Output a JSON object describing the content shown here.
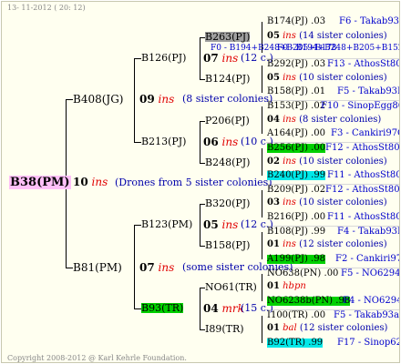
{
  "header": {
    "date": "13- 11-2012 ( 20: 12)"
  },
  "footer": {
    "copyright": "Copyright 2008-2012 @ Karl Kehrle Foundation."
  },
  "root": {
    "name": "B38(PM)",
    "year": "10",
    "tag": "ins",
    "note": "(Drones from 5 sister colonies)"
  },
  "gen1": {
    "sire": "B408(JG)",
    "sire_year": "09",
    "sire_tag": "ins",
    "sire_note": "(8 sister colonies)",
    "dam": "B81(PM)",
    "dam_year": "07",
    "dam_tag": "ins",
    "dam_note": "(some sister colonies)"
  },
  "gen2": [
    {
      "name": "B126(PJ)",
      "year": "07",
      "tag": "ins",
      "note": "(12 c.)"
    },
    {
      "name": "B213(PJ)",
      "year": "06",
      "tag": "ins",
      "note": "(10 c.)"
    },
    {
      "name": "B123(PM)",
      "year": "05",
      "tag": "ins",
      "note": "(12 c.)"
    },
    {
      "name": "B93(TR)",
      "year": "04",
      "tag": "mrk",
      "note": "(15 c.)"
    }
  ],
  "gen3": [
    "B263(PJ)",
    "B124(PJ)",
    "P206(PJ)",
    "B248(PJ)",
    "B320(PJ)",
    "B158(PJ)",
    "NO61(TR)",
    "I89(TR)"
  ],
  "gen3_extra": {
    "overlap": "F0 - B194+B248+B205+B178"
  },
  "g3y": [
    {
      "year": "05",
      "tag": "ins",
      "note": "(14 sister colonies)"
    },
    {
      "year": "05",
      "tag": "ins",
      "note": "(10 sister colonies)"
    },
    {
      "year": "04",
      "tag": "ins",
      "note": "(8 sister colonies)"
    },
    {
      "year": "02",
      "tag": "ins",
      "note": "(10 sister colonies)"
    },
    {
      "year": "03",
      "tag": "ins",
      "note": "(10 sister colonies)"
    },
    {
      "year": "01",
      "tag": "ins",
      "note": "(12 sister colonies)"
    },
    {
      "year": "01",
      "tag": "hbpn",
      "note": ""
    },
    {
      "year": "01",
      "tag": "bal",
      "note": "(12 sister colonies)"
    }
  ],
  "gen4_extra": {
    "overlap2": "F0 - B194+B248+B205+B152+B178+B354"
  },
  "gen4": [
    {
      "name": "B174(PJ)",
      "val": ".03",
      "origin": "F6 - Takab93R"
    },
    {
      "name": "B292(PJ)",
      "val": ".03",
      "origin": "F13 - AthosSt80R"
    },
    {
      "name": "B158(PJ)",
      "val": ".01",
      "origin": "F5 - Takab93R"
    },
    {
      "name": "B153(PJ)",
      "val": ".02",
      "origin": "F10 - SinopEgg86R"
    },
    {
      "name": "A164(PJ)",
      "val": ".00",
      "origin": "F3 - Cankiri97Q"
    },
    {
      "name": "B256(PJ)",
      "val": ".00",
      "origin": "F12 - AthosSt80R"
    },
    {
      "name": "B240(PJ)",
      "val": ".99",
      "origin": "F11 - AthosSt80R"
    },
    {
      "name": "B209(PJ)",
      "val": ".02",
      "origin": "F12 - AthosSt80R"
    },
    {
      "name": "B216(PJ)",
      "val": ".00",
      "origin": "F11 - AthosSt80R"
    },
    {
      "name": "B108(PJ)",
      "val": ".99",
      "origin": "F4 - Takab93R"
    },
    {
      "name": "A199(PJ)",
      "val": ".98",
      "origin": "F2 - Cankiri97Q"
    },
    {
      "name": "NO638(PN)",
      "val": ".00",
      "origin": "F5 - NO6294R"
    },
    {
      "name": "NO6238b(PN)",
      "val": ".98",
      "origin": "F4 - NO6294R"
    },
    {
      "name": "I100(TR)",
      "val": ".00",
      "origin": "F5 - Takab93aR"
    },
    {
      "name": "B92(TR)",
      "val": ".99",
      "origin": "F17 - Sinop62R"
    }
  ]
}
